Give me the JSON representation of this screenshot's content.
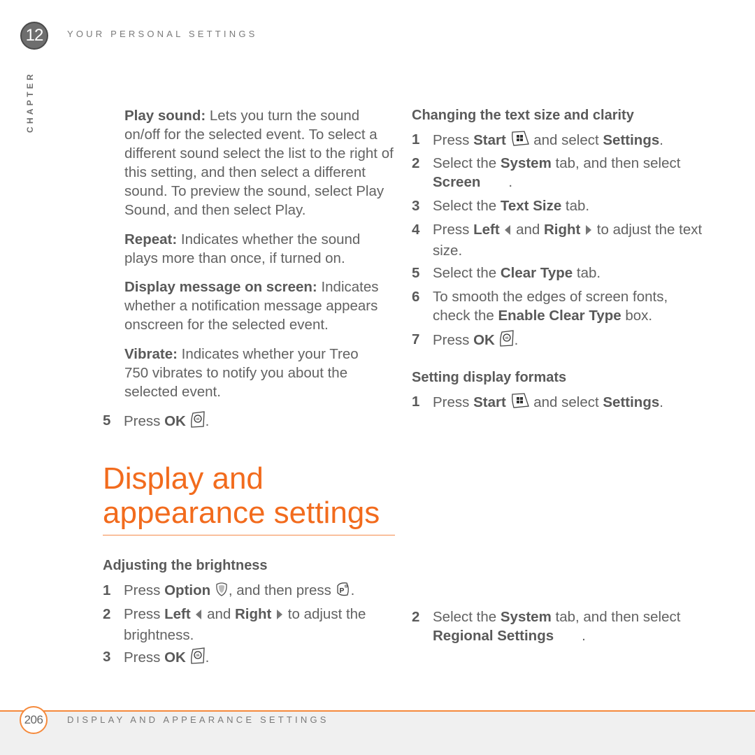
{
  "header": {
    "chapter_number": "12",
    "chapter_title": "YOUR PERSONAL SETTINGS",
    "chapter_label": "CHAPTER"
  },
  "left_column": {
    "paragraphs": [
      {
        "term": "Play sound:",
        "text": " Lets you turn the sound on/off for the selected event. To select a different sound select the list to the right of this setting, and then select a different sound. To preview the sound, select Play Sound, and then select Play."
      },
      {
        "term": "Repeat:",
        "text": " Indicates whether the sound plays more than once, if turned on."
      },
      {
        "term": "Display message on screen:",
        "text": " Indicates whether a notification message appears onscreen for the selected event."
      },
      {
        "term": "Vibrate:",
        "text": " Indicates whether your Treo 750 vibrates to notify you about the selected event."
      }
    ],
    "step5": {
      "num": "5",
      "pre": "Press ",
      "bold": "OK",
      "post": "."
    }
  },
  "section": {
    "title_line1": "Display and",
    "title_line2": "appearance settings"
  },
  "brightness": {
    "heading": "Adjusting the brightness",
    "steps": [
      {
        "num": "1",
        "a": "Press ",
        "b": "Option",
        "c": ", and then press ",
        "d": "."
      },
      {
        "num": "2",
        "a": "Press ",
        "b": "Left",
        "c": " and ",
        "d": "Right",
        "e": " to adjust the brightness."
      },
      {
        "num": "3",
        "a": "Press ",
        "b": "OK",
        "c": "."
      }
    ]
  },
  "text_size": {
    "heading": "Changing the text size and clarity",
    "steps": [
      {
        "num": "1",
        "a": "Press ",
        "b": "Start",
        "c": " and select ",
        "d": "Settings",
        "e": "."
      },
      {
        "num": "2",
        "a": "Select the ",
        "b": "System",
        "c": " tab, and then select ",
        "d": "Screen",
        "e": "."
      },
      {
        "num": "3",
        "a": "Select the ",
        "b": "Text Size",
        "c": " tab."
      },
      {
        "num": "4",
        "a": "Press ",
        "b": "Left",
        "c": " and ",
        "d": "Right",
        "e": " to adjust the text size."
      },
      {
        "num": "5",
        "a": "Select the ",
        "b": "Clear Type",
        "c": " tab."
      },
      {
        "num": "6",
        "a": "To smooth the edges of screen fonts, check the ",
        "b": "Enable Clear Type",
        "c": " box."
      },
      {
        "num": "7",
        "a": "Press ",
        "b": "OK",
        "c": "."
      }
    ]
  },
  "display_formats": {
    "heading": "Setting display formats",
    "steps": [
      {
        "num": "1",
        "a": "Press ",
        "b": "Start",
        "c": " and select ",
        "d": "Settings",
        "e": "."
      },
      {
        "num": "2",
        "a": "Select the ",
        "b": "System",
        "c": " tab, and then select ",
        "d": "Regional Settings",
        "e": "."
      }
    ]
  },
  "footer": {
    "page_number": "206",
    "section_title": "DISPLAY AND APPEARANCE SETTINGS"
  },
  "colors": {
    "accent": "#f26b1d",
    "text": "#626262",
    "footer_bg": "#f0f0f0"
  }
}
